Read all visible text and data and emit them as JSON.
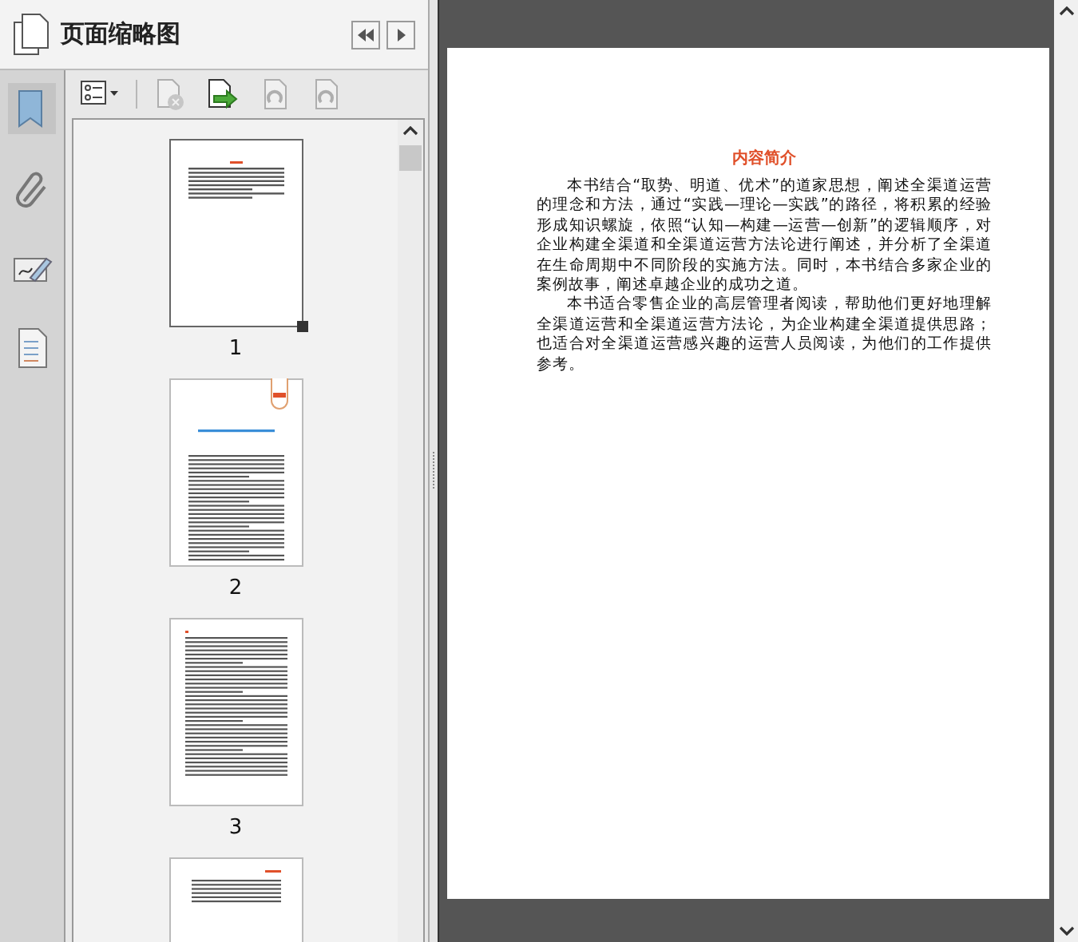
{
  "panel": {
    "title": "页面缩略图"
  },
  "rail": [
    {
      "kind": "bookmark",
      "selected": true
    },
    {
      "kind": "attachment",
      "selected": false
    },
    {
      "kind": "signature",
      "selected": false
    },
    {
      "kind": "layers",
      "selected": false
    }
  ],
  "toolbar": [
    {
      "kind": "options",
      "disabled": false
    },
    {
      "kind": "delete",
      "disabled": true
    },
    {
      "kind": "insert",
      "disabled": false
    },
    {
      "kind": "rotate-left",
      "disabled": true
    },
    {
      "kind": "rotate-right",
      "disabled": true
    }
  ],
  "thumbnails": [
    {
      "label": "1",
      "selected": true,
      "kind": "intro"
    },
    {
      "label": "2",
      "selected": false,
      "kind": "preface"
    },
    {
      "label": "3",
      "selected": false,
      "kind": "text"
    },
    {
      "kind": "partial",
      "selected": false
    }
  ],
  "document": {
    "heading": "内容简介",
    "paragraphs": [
      "本书结合“取势、明道、优术”的道家思想，阐述全渠道运营的理念和方法，通过“实践—理论—实践”的路径，将积累的经验形成知识螺旋，依照“认知—构建—运营—创新”的逻辑顺序，对企业构建全渠道和全渠道运营方法论进行阐述，并分析了全渠道在生命周期中不同阶段的实施方法。同时，本书结合多家企业的案例故事，阐述卓越企业的成功之道。",
      "本书适合零售企业的高层管理者阅读，帮助他们更好地理解全渠道运营和全渠道运营方法论，为企业构建全渠道提供思路；也适合对全渠道运营感兴趣的运营人员阅读，为他们的工作提供参考。"
    ]
  }
}
